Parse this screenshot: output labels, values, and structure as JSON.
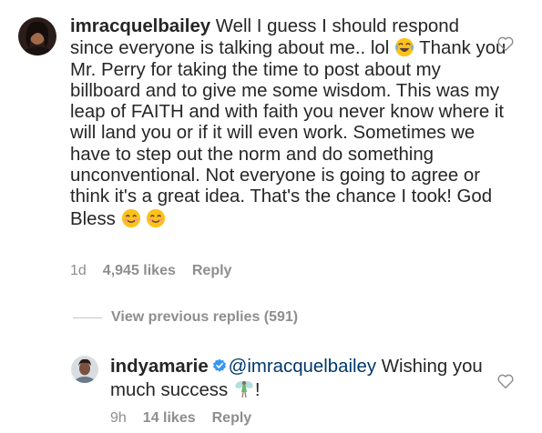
{
  "comment1": {
    "username": "imracquelbailey",
    "text_part1": " Well I guess I should respond since everyone is talking about me.. lol ",
    "text_part2": " Thank you Mr. Perry for taking the time to post about my billboard and to give me some wisdom. This was my leap of FAITH and with faith you never know where it will land you or if it will even work. Sometimes we have to step out the norm and do something unconventional. Not everyone is going to agree or think it's a great idea. That's the chance I took! God Bless ",
    "time": "1d",
    "likes": "4,945 likes",
    "reply": "Reply",
    "emoji_laugh": "face-with-tears-of-joy-icon",
    "emoji_smile": "smiling-face-icon"
  },
  "replies": {
    "view_label": "View previous replies (591)"
  },
  "comment2": {
    "username": "indyamarie",
    "mention": "@imracquelbailey",
    "text": " Wishing you much success ",
    "text_end": "!",
    "time": "9h",
    "likes": "14 likes",
    "reply": "Reply",
    "badge": "verified-badge-icon",
    "emoji": "fairy-icon"
  },
  "colors": {
    "text": "#262626",
    "meta": "#8e8e8e",
    "mention": "#00376b",
    "verified": "#3897f0"
  }
}
